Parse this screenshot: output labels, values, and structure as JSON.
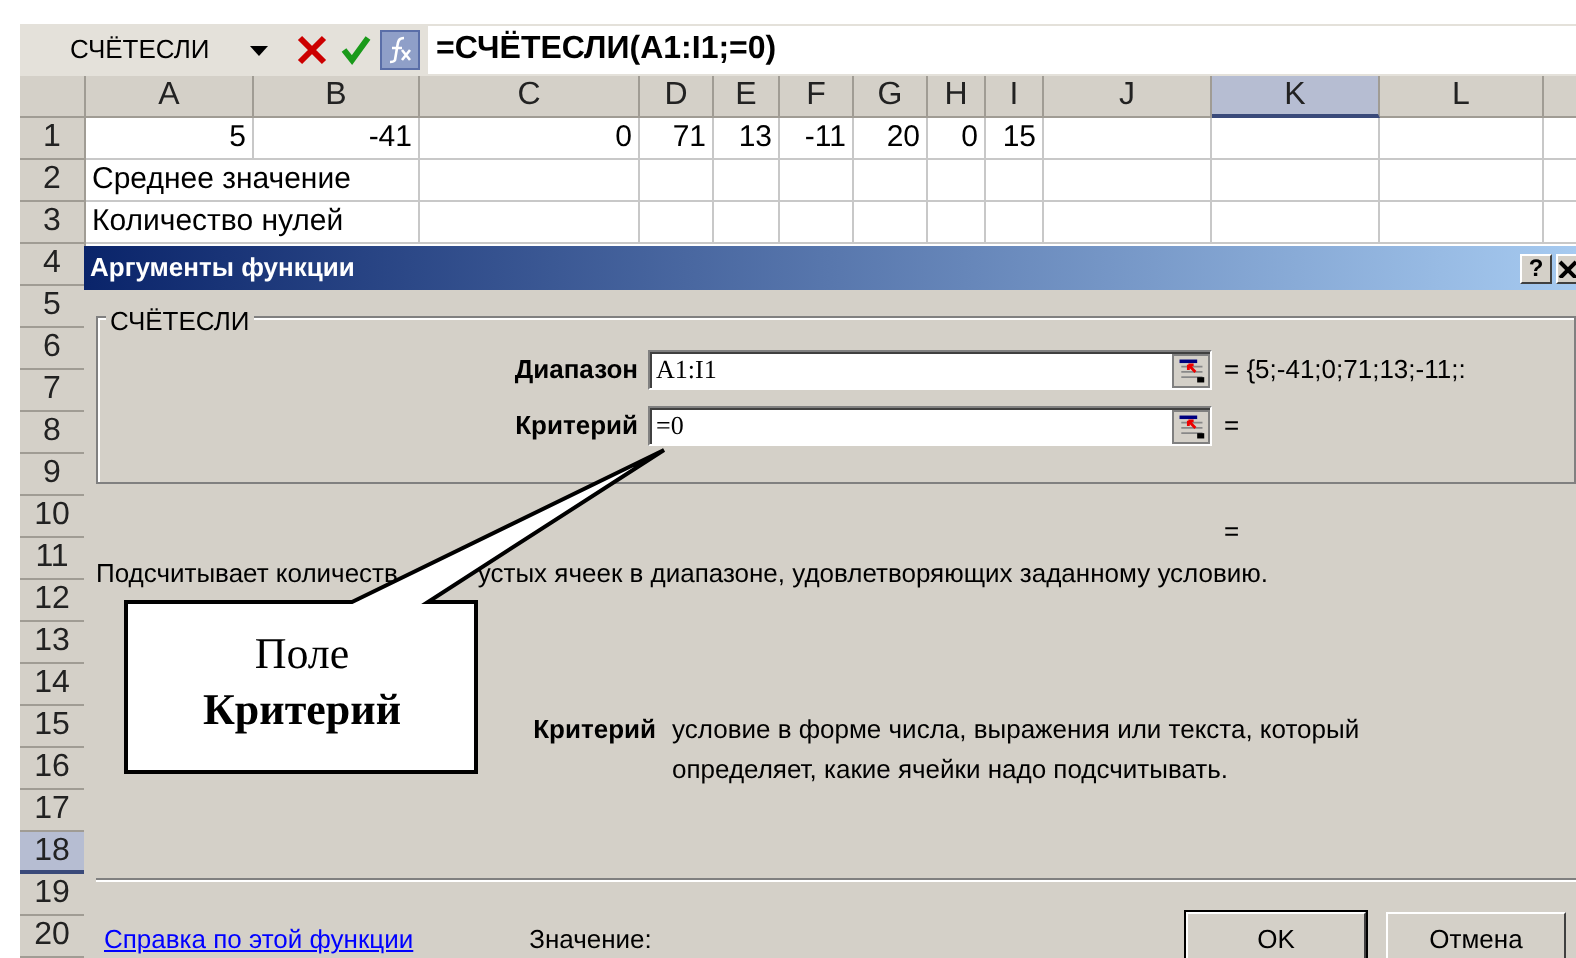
{
  "formula_bar": {
    "name_box": "СЧЁТЕСЛИ",
    "formula": "=СЧЁТЕСЛИ(A1:I1;=0)"
  },
  "columns": [
    {
      "label": "A",
      "selected": false
    },
    {
      "label": "B",
      "selected": false
    },
    {
      "label": "C",
      "selected": false
    },
    {
      "label": "D",
      "selected": false
    },
    {
      "label": "E",
      "selected": false
    },
    {
      "label": "F",
      "selected": false
    },
    {
      "label": "G",
      "selected": false
    },
    {
      "label": "H",
      "selected": false
    },
    {
      "label": "I",
      "selected": false
    },
    {
      "label": "J",
      "selected": false
    },
    {
      "label": "K",
      "selected": true
    },
    {
      "label": "L",
      "selected": false
    }
  ],
  "rows": [
    {
      "label": "1",
      "selected": false,
      "values": [
        "5",
        "-41",
        "0",
        "71",
        "13",
        "-11",
        "20",
        "0",
        "15"
      ]
    },
    {
      "label": "2",
      "selected": false,
      "values": [
        "Среднее значение"
      ]
    },
    {
      "label": "3",
      "selected": false,
      "values": [
        "Количество нулей"
      ]
    },
    {
      "label": "4",
      "selected": false
    },
    {
      "label": "5",
      "selected": false
    },
    {
      "label": "6",
      "selected": false
    },
    {
      "label": "7",
      "selected": false
    },
    {
      "label": "8",
      "selected": false
    },
    {
      "label": "9",
      "selected": false
    },
    {
      "label": "10",
      "selected": false
    },
    {
      "label": "11",
      "selected": false
    },
    {
      "label": "12",
      "selected": false
    },
    {
      "label": "13",
      "selected": false
    },
    {
      "label": "14",
      "selected": false
    },
    {
      "label": "15",
      "selected": false
    },
    {
      "label": "16",
      "selected": false
    },
    {
      "label": "17",
      "selected": false
    },
    {
      "label": "18",
      "selected": true
    },
    {
      "label": "19",
      "selected": false
    },
    {
      "label": "20",
      "selected": false
    }
  ],
  "dialog": {
    "title": "Аргументы функции",
    "help_button": "?",
    "group": {
      "title": "СЧЁТЕСЛИ",
      "arguments": [
        {
          "label": "Диапазон",
          "value": "A1:I1",
          "result": "= {5;-41;0;71;13;-11;:"
        },
        {
          "label": "Критерий",
          "value": "=0",
          "result": "="
        }
      ]
    },
    "formula_result": "=",
    "description": [
      "Подсчитывает количеств",
      "устых ячеек в диапазоне, удовлетворяющих заданному условию."
    ],
    "argument_help": {
      "label": "Критерий",
      "text": "условие в форме числа, выражения или текста, который определяет, какие ячейки надо подсчитывать."
    },
    "help_link": "Справка по этой функции",
    "value_label": "Значение:",
    "buttons": [
      {
        "label": "OK",
        "default": true
      },
      {
        "label": "Отмена",
        "default": false
      }
    ]
  },
  "callout": {
    "text": "Поле **Критерий**"
  }
}
